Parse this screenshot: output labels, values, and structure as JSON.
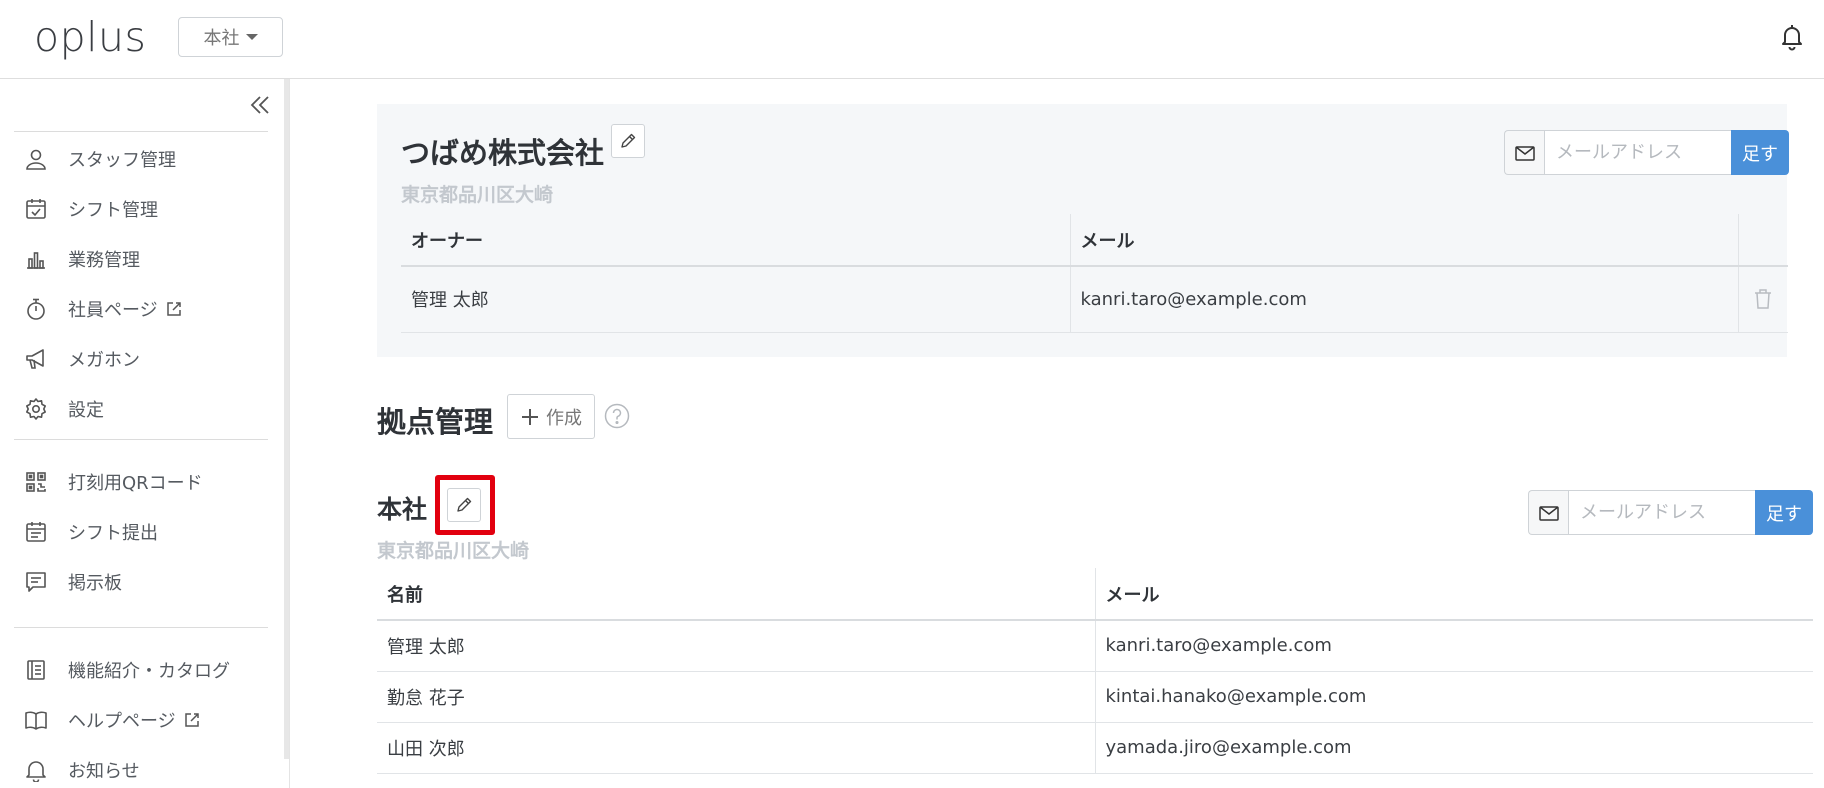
{
  "header": {
    "logo": "oplus",
    "branch_select": "本社"
  },
  "sidebar": {
    "items": [
      {
        "label": "スタッフ管理",
        "icon": "person-icon"
      },
      {
        "label": "シフト管理",
        "icon": "calendar-check-icon"
      },
      {
        "label": "業務管理",
        "icon": "bar-chart-icon"
      },
      {
        "label": "社員ページ",
        "icon": "stopwatch-icon",
        "external": true
      },
      {
        "label": "メガホン",
        "icon": "megaphone-icon"
      },
      {
        "label": "設定",
        "icon": "gear-icon"
      },
      {
        "label": "打刻用QRコード",
        "icon": "qr-code-icon"
      },
      {
        "label": "シフト提出",
        "icon": "calendar-icon"
      },
      {
        "label": "掲示板",
        "icon": "message-board-icon"
      },
      {
        "label": "機能紹介・カタログ",
        "icon": "catalog-icon"
      },
      {
        "label": "ヘルプページ",
        "icon": "book-icon",
        "external": true
      },
      {
        "label": "お知らせ",
        "icon": "bell-icon"
      }
    ]
  },
  "company": {
    "name": "つばめ株式会社",
    "address": "東京都品川区大崎",
    "mail_placeholder": "メールアドレス",
    "add_label": "足す",
    "table": {
      "headers": [
        "オーナー",
        "メール"
      ],
      "rows": [
        {
          "name": "管理 太郎",
          "email": "kanri.taro@example.com"
        }
      ]
    }
  },
  "locations": {
    "title": "拠点管理",
    "create_label": "作成"
  },
  "branch": {
    "name": "本社",
    "address": "東京都品川区大崎",
    "mail_placeholder": "メールアドレス",
    "add_label": "足す",
    "table": {
      "headers": [
        "名前",
        "メール"
      ],
      "rows": [
        {
          "name": "管理 太郎",
          "email": "kanri.taro@example.com"
        },
        {
          "name": "勤怠 花子",
          "email": "kintai.hanako@example.com"
        },
        {
          "name": "山田 次郎",
          "email": "yamada.jiro@example.com"
        }
      ]
    }
  },
  "colors": {
    "accent": "#4a90d9",
    "highlight": "#e2000f",
    "card_bg": "#f5f7f9"
  }
}
